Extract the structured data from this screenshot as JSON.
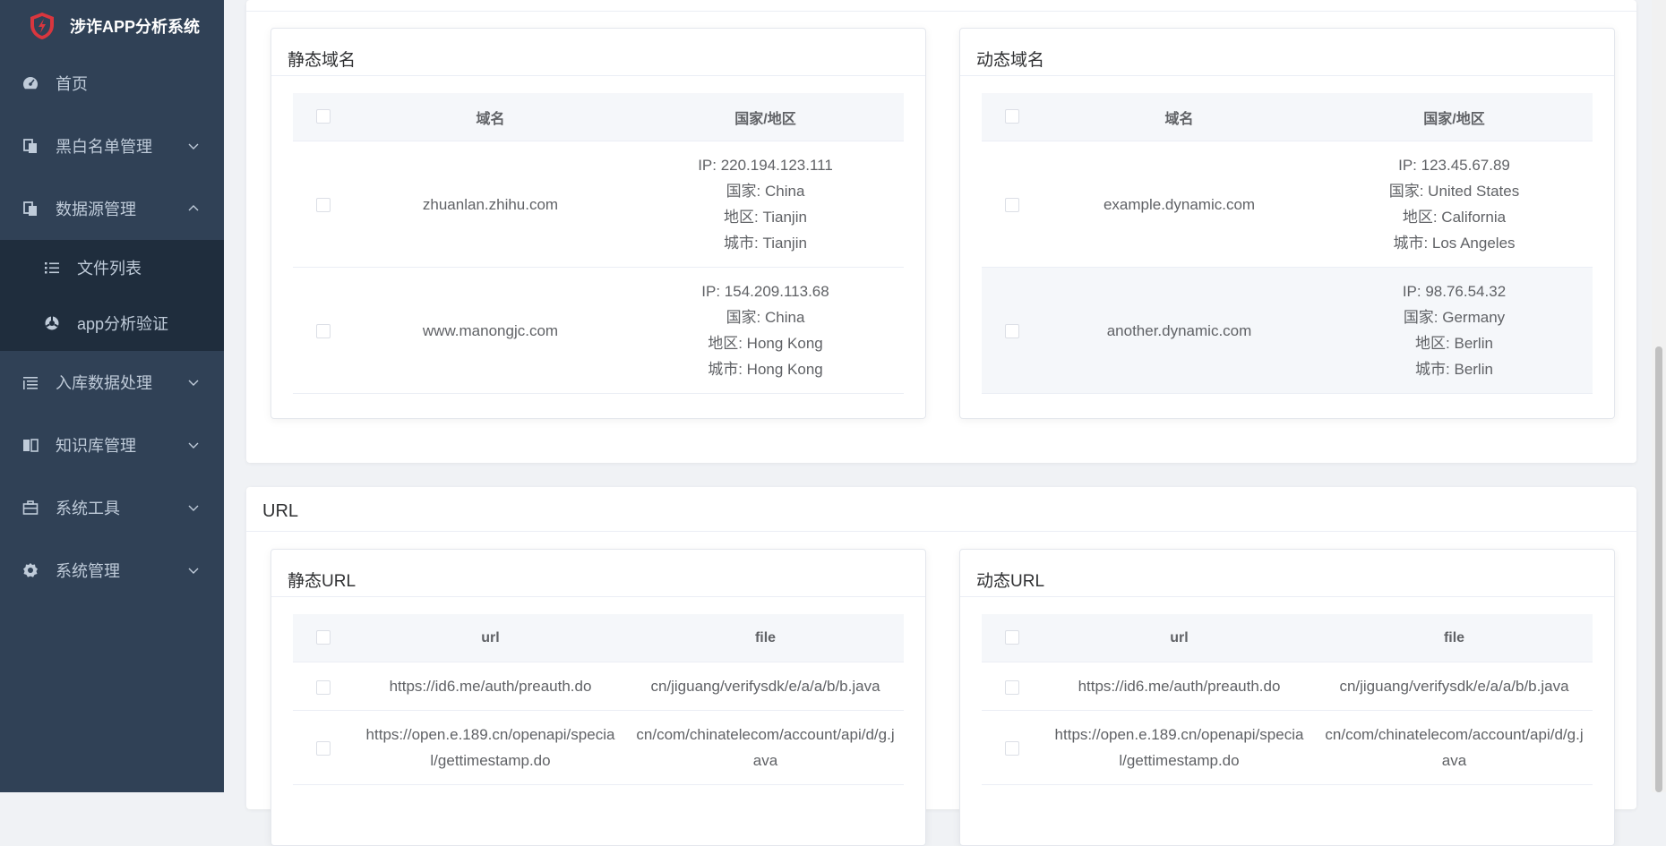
{
  "app": {
    "title": "涉诈APP分析系统"
  },
  "sidebar": {
    "items": [
      {
        "label": "首页",
        "icon": "dashboard-icon",
        "expandable": false
      },
      {
        "label": "黑白名单管理",
        "icon": "documents-icon",
        "expandable": true,
        "expanded": false
      },
      {
        "label": "数据源管理",
        "icon": "documents-icon",
        "expandable": true,
        "expanded": true,
        "children": [
          {
            "label": "文件列表",
            "icon": "list-icon"
          },
          {
            "label": "app分析验证",
            "icon": "analysis-icon"
          }
        ]
      },
      {
        "label": "入库数据处理",
        "icon": "sort-list-icon",
        "expandable": true,
        "expanded": false
      },
      {
        "label": "知识库管理",
        "icon": "book-icon",
        "expandable": true,
        "expanded": false
      },
      {
        "label": "系统工具",
        "icon": "toolbox-icon",
        "expandable": true,
        "expanded": false
      },
      {
        "label": "系统管理",
        "icon": "gear-icon",
        "expandable": true,
        "expanded": false
      }
    ]
  },
  "domains": {
    "static": {
      "title": "静态域名",
      "columns": [
        "域名",
        "国家/地区"
      ],
      "rows": [
        {
          "domain": "zhuanlan.zhihu.com",
          "ip": "IP: 220.194.123.111",
          "country": "国家: China",
          "region": "地区: Tianjin",
          "city": "城市: Tianjin"
        },
        {
          "domain": "www.manongjc.com",
          "ip": "IP: 154.209.113.68",
          "country": "国家: China",
          "region": "地区: Hong Kong",
          "city": "城市: Hong Kong"
        }
      ]
    },
    "dynamic": {
      "title": "动态域名",
      "columns": [
        "域名",
        "国家/地区"
      ],
      "rows": [
        {
          "domain": "example.dynamic.com",
          "ip": "IP: 123.45.67.89",
          "country": "国家: United States",
          "region": "地区: California",
          "city": "城市: Los Angeles"
        },
        {
          "domain": "another.dynamic.com",
          "ip": "IP: 98.76.54.32",
          "country": "国家: Germany",
          "region": "地区: Berlin",
          "city": "城市: Berlin"
        }
      ]
    }
  },
  "url_section": {
    "title": "URL",
    "static": {
      "title": "静态URL",
      "columns": [
        "url",
        "file"
      ],
      "rows": [
        {
          "url": "https://id6.me/auth/preauth.do",
          "file": "cn/jiguang/verifysdk/e/a/a/b/b.java"
        },
        {
          "url": "https://open.e.189.cn/openapi/special/gettimestamp.do",
          "file": "cn/com/chinatelecom/account/api/d/g.java"
        }
      ]
    },
    "dynamic": {
      "title": "动态URL",
      "columns": [
        "url",
        "file"
      ],
      "rows": [
        {
          "url": "https://id6.me/auth/preauth.do",
          "file": "cn/jiguang/verifysdk/e/a/a/b/b.java"
        },
        {
          "url": "https://open.e.189.cn/openapi/special/gettimestamp.do",
          "file": "cn/com/chinatelecom/account/api/d/g.java"
        }
      ]
    }
  },
  "colors": {
    "sidebar_bg": "#304156",
    "submenu_bg": "#1f2d3d",
    "sidebar_text": "#bfcbd9",
    "logo_red": "#d9363e",
    "page_bg": "#f0f2f5"
  }
}
